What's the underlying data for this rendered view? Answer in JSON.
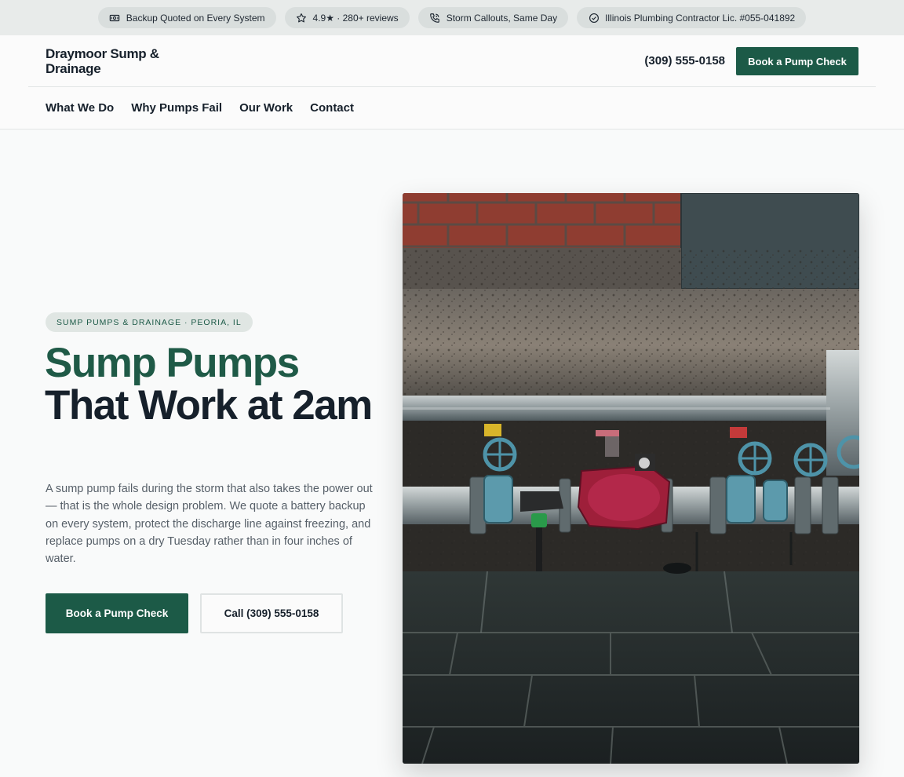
{
  "trust_bar": [
    {
      "icon": "cash-icon",
      "label": "Backup Quoted on Every System"
    },
    {
      "icon": "star-icon",
      "label": "4.9★ · 280+ reviews"
    },
    {
      "icon": "phone-icon",
      "label": "Storm Callouts, Same Day"
    },
    {
      "icon": "check-circle-icon",
      "label": "Illinois Plumbing Contractor Lic. #055-041892"
    }
  ],
  "header": {
    "brand": "Draymoor Sump & Drainage",
    "phone": "(309) 555-0158",
    "cta": "Book a Pump Check"
  },
  "nav": {
    "items": [
      {
        "label": "What We Do"
      },
      {
        "label": "Why Pumps Fail"
      },
      {
        "label": "Our Work"
      },
      {
        "label": "Contact"
      }
    ]
  },
  "hero": {
    "badge": "SUMP PUMPS & DRAINAGE · PEORIA, IL",
    "title_accent": "Sump Pumps",
    "title_rest": "That Work at 2am",
    "lede": "A sump pump fails during the storm that also takes the power out — that is the whole design problem. We quote a battery backup on every system, protect the discharge line against freezing, and replace pumps on a dry Tuesday rather than in four inches of water.",
    "primary_cta": "Book a Pump Check",
    "secondary_cta": "Call (309) 555-0158"
  },
  "colors": {
    "brand_green": "#1c5a47",
    "ink": "#16202b",
    "muted": "#565f68",
    "page_bg": "#f9fafa"
  }
}
